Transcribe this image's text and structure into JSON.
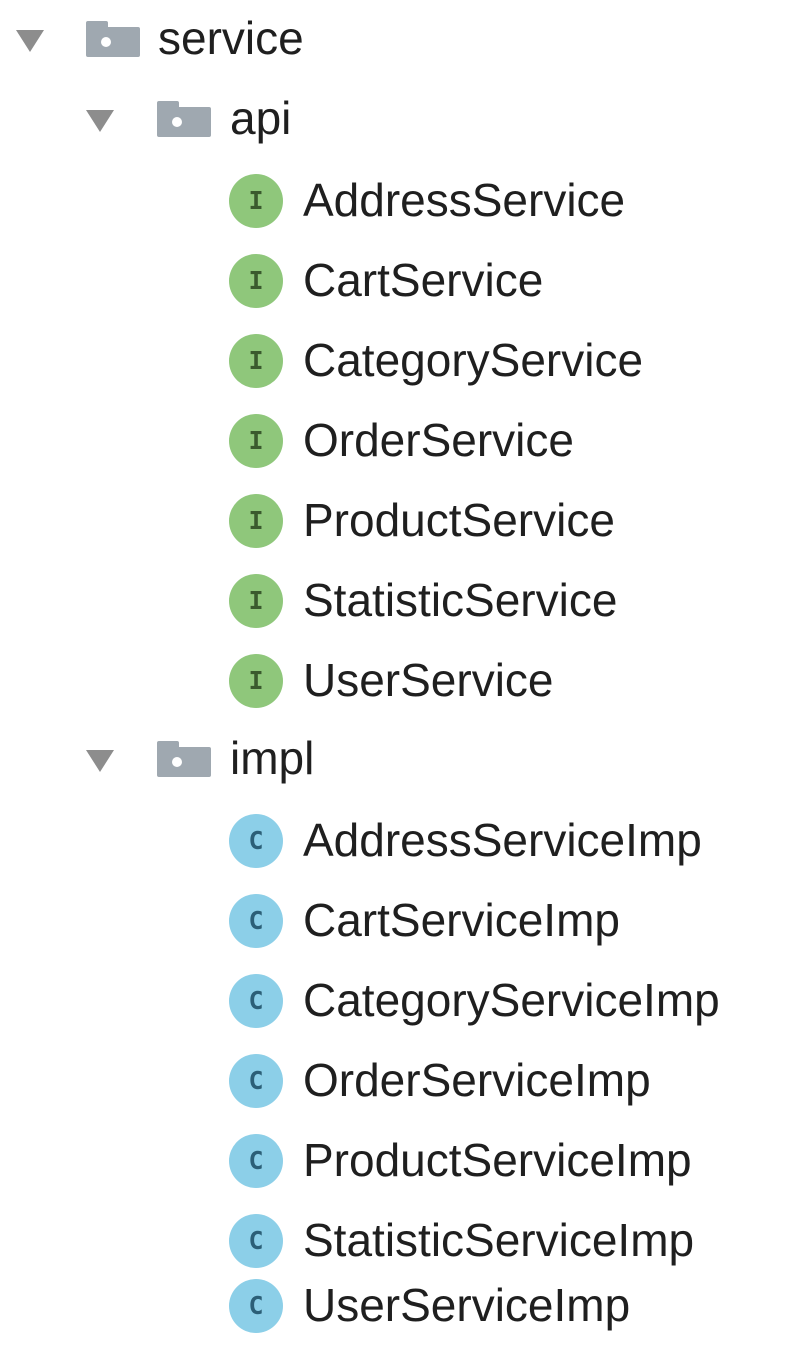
{
  "tree": {
    "root": {
      "label": "service",
      "icon": "folder-icon",
      "expanded": true,
      "children": [
        {
          "label": "api",
          "icon": "folder-icon",
          "expanded": true,
          "badge_letter": "I",
          "badge_color": "#8fc77b",
          "items": [
            "AddressService",
            "CartService",
            "CategoryService",
            "OrderService",
            "ProductService",
            "StatisticService",
            "UserService"
          ]
        },
        {
          "label": "impl",
          "icon": "folder-icon",
          "expanded": true,
          "badge_letter": "C",
          "badge_color": "#8ccfe8",
          "items": [
            "AddressServiceImp",
            "CartServiceImp",
            "CategoryServiceImp",
            "OrderServiceImp",
            "ProductServiceImp",
            "StatisticServiceImp",
            "UserServiceImp"
          ]
        }
      ]
    }
  }
}
